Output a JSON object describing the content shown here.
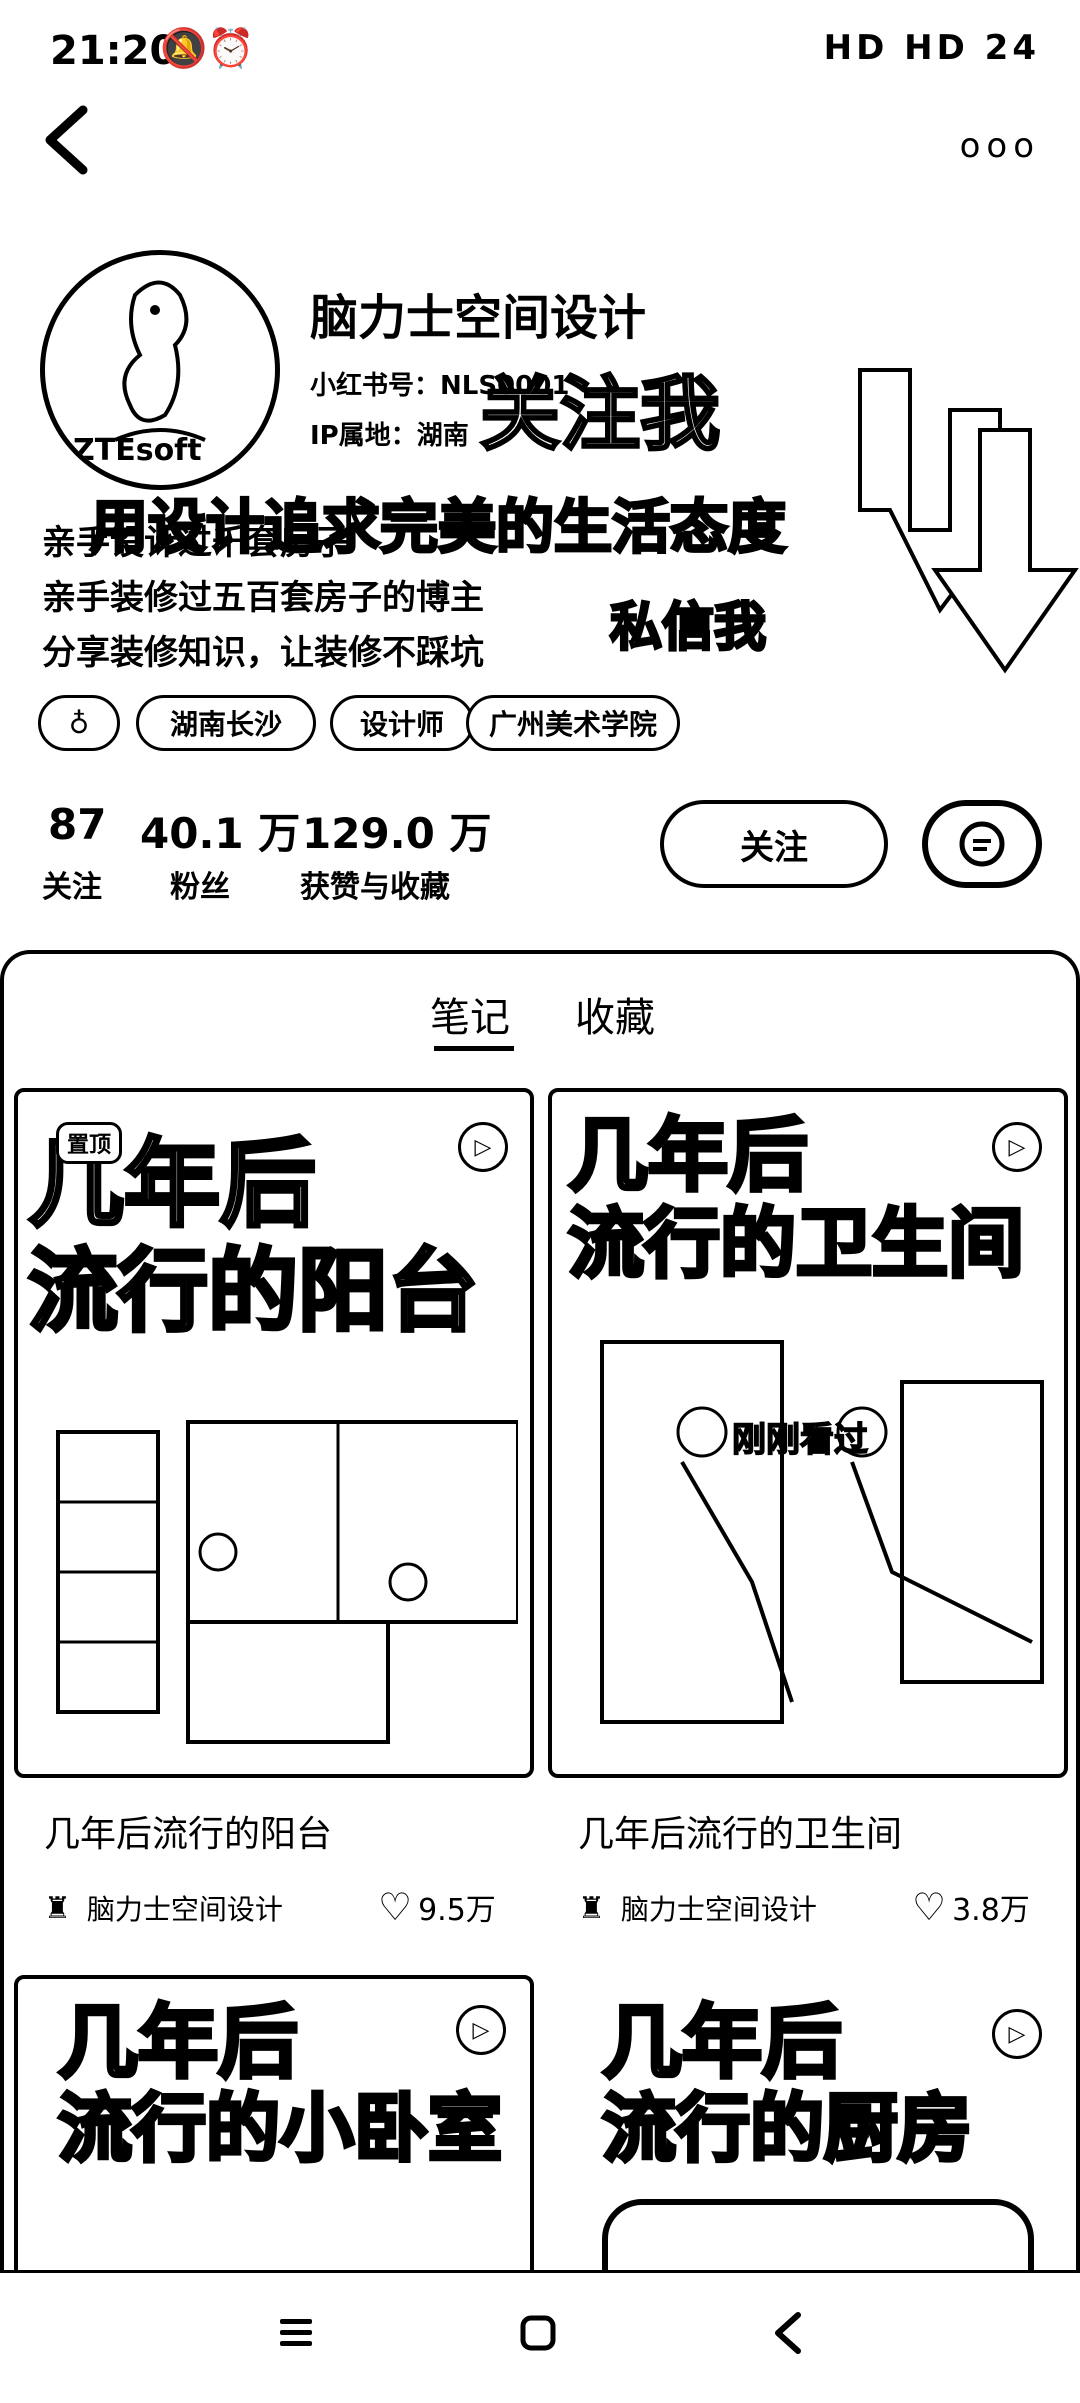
{
  "status": {
    "time": "21:20",
    "icons_text": "HD HD 24"
  },
  "header": {
    "more_label": "ooo"
  },
  "profile": {
    "name": "脑力士空间设计",
    "red_id": "小红书号：NLS0001",
    "ip_location": "IP属地：湖南",
    "avatar_text": "ZTEsoft",
    "poster_text_follow": "关注我",
    "poster_text_2": "用设计追求完美的生活态度",
    "poster_text_3": "私信我",
    "bio": [
      "亲手设计过千套房子",
      "亲手装修过五百套房子的博主",
      "分享装修知识，让装修不踩坑"
    ]
  },
  "tags": [
    "湖南长沙",
    "设计师",
    "广州美术学院"
  ],
  "stats": [
    {
      "value": "87",
      "label": "关注"
    },
    {
      "value": "40.1 万",
      "label": "粉丝"
    },
    {
      "value": "129.0 万",
      "label": "获赞与收藏"
    }
  ],
  "actions": {
    "follow_label": "关注"
  },
  "tabs": [
    "笔记",
    "收藏"
  ],
  "notes": [
    {
      "cover_line1": "几年后",
      "cover_line2": "流行的阳台",
      "badge": "置顶",
      "title": "几年后流行的阳台",
      "author": "脑力士空间设计",
      "likes": "9.5万"
    },
    {
      "cover_line1": "几年后",
      "cover_line2": "流行的卫生间",
      "overlay": "刚刚看过",
      "title": "几年后流行的卫生间",
      "author": "脑力士空间设计",
      "likes": "3.8万"
    },
    {
      "cover_line1": "几年后",
      "cover_line2": "流行的小卧室"
    },
    {
      "cover_line1": "几年后",
      "cover_line2": "流行的厨房"
    }
  ]
}
